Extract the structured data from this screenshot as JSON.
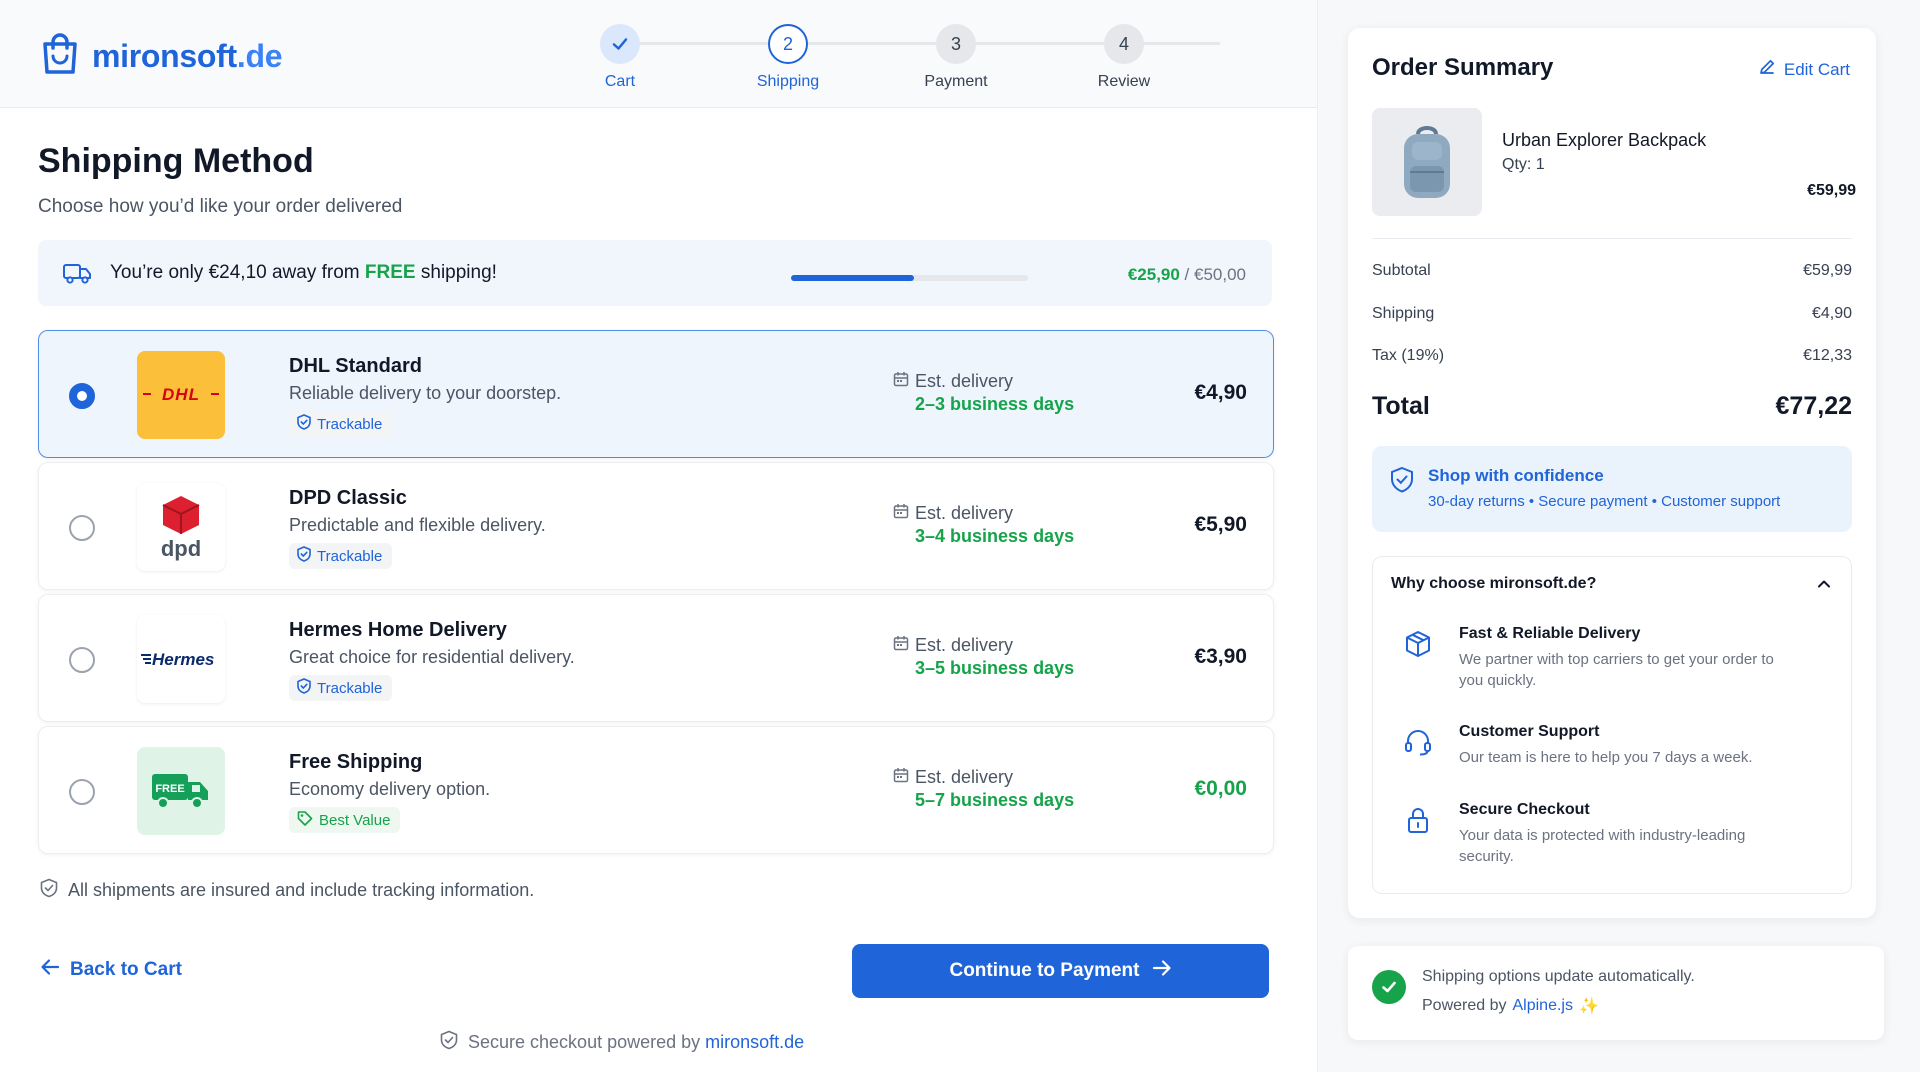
{
  "brand": {
    "name": "mironsoft",
    "tld": ".de"
  },
  "steps": [
    {
      "number": "1",
      "label": "Cart",
      "state": "done"
    },
    {
      "number": "2",
      "label": "Shipping",
      "state": "active"
    },
    {
      "number": "3",
      "label": "Payment",
      "state": "pending"
    },
    {
      "number": "4",
      "label": "Review",
      "state": "pending"
    }
  ],
  "main": {
    "title": "Shipping Method",
    "subtitle": "Choose how you’d like your order delivered"
  },
  "free_shipping": {
    "prefix": "You’re only €24,10 away from ",
    "free_word": "FREE",
    "suffix": " shipping!",
    "current": "€25,90",
    "separator": " / ",
    "threshold": "€50,00",
    "progress_fraction": 0.518
  },
  "options": [
    {
      "name": "DHL Standard",
      "desc": "Reliable delivery to your doorstep.",
      "badge": "Trackable",
      "est_label": "Est. delivery",
      "est_days": "2–3 business days",
      "price": "€4,90",
      "selected": true,
      "logo_text": "DHL"
    },
    {
      "name": "DPD Classic",
      "desc": "Predictable and flexible delivery.",
      "badge": "Trackable",
      "est_label": "Est. delivery",
      "est_days": "3–4 business days",
      "price": "€5,90",
      "selected": false,
      "logo_text": "dpd"
    },
    {
      "name": "Hermes Home Delivery",
      "desc": "Great choice for residential delivery.",
      "badge": "Trackable",
      "est_label": "Est. delivery",
      "est_days": "3–5 business days",
      "price": "€3,90",
      "selected": false,
      "logo_text": "Hermes"
    },
    {
      "name": "Free Shipping",
      "desc": "Economy delivery option.",
      "badge": "Best Value",
      "est_label": "Est. delivery",
      "est_days": "5–7 business days",
      "price": "€0,00",
      "selected": false,
      "logo_text": "FREE"
    }
  ],
  "insured_note": "All shipments are insured and include tracking information.",
  "back_label": "Back to Cart",
  "continue_label": "Continue to Payment",
  "powered": {
    "text": "Secure checkout powered by ",
    "brand": "mironsoft.de"
  },
  "summary": {
    "title": "Order Summary",
    "edit_label": "Edit Cart",
    "product": {
      "name": "Urban Explorer Backpack",
      "qty": "Qty: 1",
      "price": "€59,99"
    },
    "rows": [
      {
        "label": "Subtotal",
        "value": "€59,99"
      },
      {
        "label": "Shipping",
        "value": "€4,90"
      },
      {
        "label": "Tax (19%)",
        "value": "€12,33"
      }
    ],
    "total_label": "Total",
    "total_value": "€77,22",
    "confidence": {
      "title": "Shop with confidence",
      "sub": "30-day returns • Secure payment • Customer support"
    },
    "why": {
      "title": "Why choose mironsoft.de?",
      "items": [
        {
          "title": "Fast & Reliable Delivery",
          "desc": "We partner with top carriers to get your order to you quickly.",
          "icon": "box-icon"
        },
        {
          "title": "Customer Support",
          "desc": "Our team is here to help you 7 days a week.",
          "icon": "headset-icon"
        },
        {
          "title": "Secure Checkout",
          "desc": "Your data is protected with industry-leading security.",
          "icon": "lock-icon"
        }
      ]
    }
  },
  "auto_note": {
    "line1": "Shipping options update automatically.",
    "line2_prefix": "Powered by ",
    "line2_brand": "Alpine.js",
    "sparkle": "✨"
  },
  "colors": {
    "primary": "#1f64d8",
    "success": "#16a34a",
    "dhl_yellow": "#fbbf3a",
    "dpd_red": "#dc2030"
  }
}
